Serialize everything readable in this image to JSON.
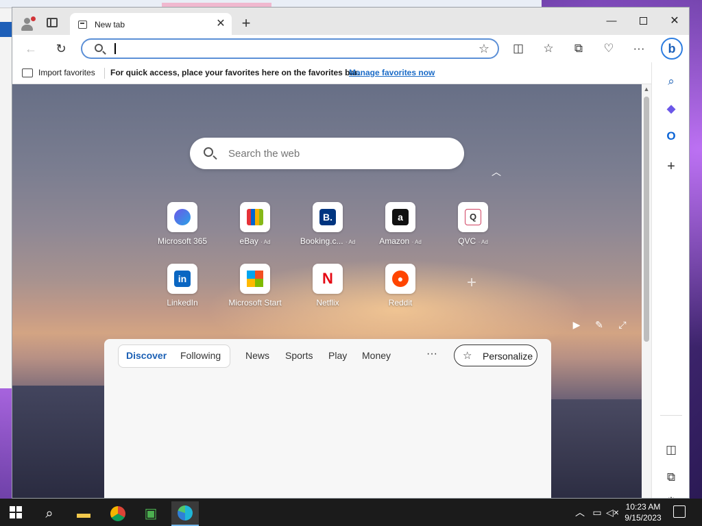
{
  "browser": {
    "tab_title": "New tab",
    "address_value": "",
    "favorites_bar": {
      "import_label": "Import favorites",
      "message": "For quick access, place your favorites here on the favorites bar.",
      "manage_link": "Manage favorites now"
    }
  },
  "newtab": {
    "search_placeholder": "Search the web",
    "tiles": [
      {
        "name": "Microsoft 365",
        "ad": ""
      },
      {
        "name": "eBay",
        "ad": "· Ad"
      },
      {
        "name": "Booking.c...",
        "ad": "· Ad"
      },
      {
        "name": "Amazon",
        "ad": "· Ad"
      },
      {
        "name": "QVC",
        "ad": "· Ad"
      },
      {
        "name": "LinkedIn",
        "ad": ""
      },
      {
        "name": "Microsoft Start",
        "ad": ""
      },
      {
        "name": "Netflix",
        "ad": ""
      },
      {
        "name": "Reddit",
        "ad": ""
      }
    ],
    "feed": {
      "tabs": [
        "Discover",
        "Following",
        "News",
        "Sports",
        "Play",
        "Money"
      ],
      "more": "···",
      "personalize": "Personalize"
    }
  },
  "taskbar": {
    "time": "10:23 AM",
    "date": "9/15/2023"
  },
  "colors": {
    "accent": "#1a5fb4",
    "link": "#1a6bc7",
    "taskbar": "#1b1b1b"
  }
}
